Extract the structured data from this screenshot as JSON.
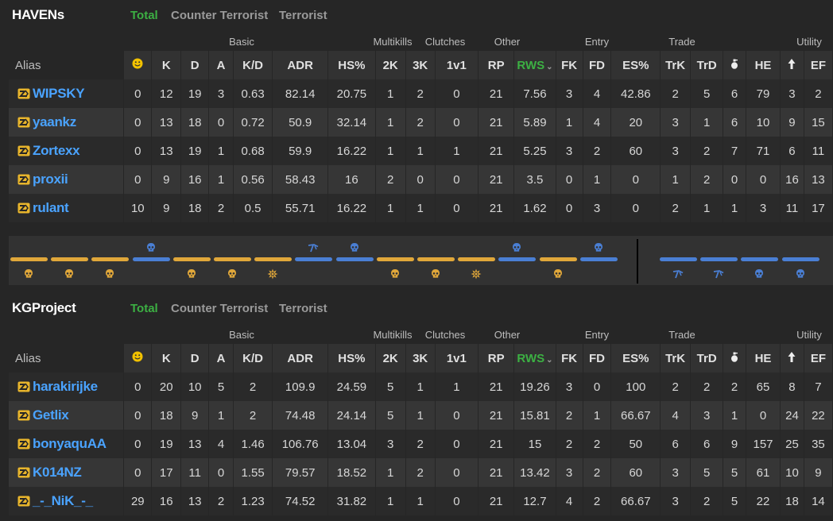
{
  "colors": {
    "accent_green": "#3cb043",
    "player_link": "#4aa3ff",
    "t_round": "#e0a73a",
    "ct_round": "#4a7fd4"
  },
  "tabs": {
    "total": "Total",
    "ct": "Counter Terrorist",
    "t": "Terrorist"
  },
  "groups": {
    "basic": "Basic",
    "multikills": "Multikills",
    "clutches": "Clutches",
    "other": "Other",
    "entry": "Entry",
    "trade": "Trade",
    "utility": "Utility"
  },
  "columns": {
    "alias": "Alias",
    "mvp_icon": "smiley-icon",
    "k": "K",
    "d": "D",
    "a": "A",
    "kd": "K/D",
    "adr": "ADR",
    "hs": "HS%",
    "mk2": "2K",
    "mk3": "3K",
    "clutch": "1v1",
    "rp": "RP",
    "rws": "RWS",
    "fk": "FK",
    "fd": "FD",
    "es": "ES%",
    "trk": "TrK",
    "trd": "TrD",
    "flash_icon": "flashbang-icon",
    "he": "HE",
    "util_icon": "arrow-up-icon",
    "ef": "EF"
  },
  "teams": [
    {
      "name": "HAVENs",
      "players": [
        {
          "alias": "WIPSKY",
          "stats": [
            "0",
            "12",
            "19",
            "3",
            "0.63",
            "82.14",
            "20.75",
            "1",
            "2",
            "0",
            "21",
            "7.56",
            "3",
            "4",
            "42.86",
            "2",
            "5",
            "6",
            "79",
            "3",
            "2"
          ]
        },
        {
          "alias": "yaankz",
          "stats": [
            "0",
            "13",
            "18",
            "0",
            "0.72",
            "50.9",
            "32.14",
            "1",
            "2",
            "0",
            "21",
            "5.89",
            "1",
            "4",
            "20",
            "3",
            "1",
            "6",
            "10",
            "9",
            "15"
          ]
        },
        {
          "alias": "Zortexx",
          "stats": [
            "0",
            "13",
            "19",
            "1",
            "0.68",
            "59.9",
            "16.22",
            "1",
            "1",
            "1",
            "21",
            "5.25",
            "3",
            "2",
            "60",
            "3",
            "2",
            "7",
            "71",
            "6",
            "11"
          ]
        },
        {
          "alias": "proxii",
          "stats": [
            "0",
            "9",
            "16",
            "1",
            "0.56",
            "58.43",
            "16",
            "2",
            "0",
            "0",
            "21",
            "3.5",
            "0",
            "1",
            "0",
            "1",
            "2",
            "0",
            "0",
            "16",
            "13"
          ]
        },
        {
          "alias": "rulant",
          "stats": [
            "10",
            "9",
            "18",
            "2",
            "0.5",
            "55.71",
            "16.22",
            "1",
            "1",
            "0",
            "21",
            "1.62",
            "0",
            "3",
            "0",
            "2",
            "1",
            "1",
            "3",
            "11",
            "17"
          ]
        }
      ]
    },
    {
      "name": "KGProject",
      "players": [
        {
          "alias": "harakirijke",
          "stats": [
            "0",
            "20",
            "10",
            "5",
            "2",
            "109.9",
            "24.59",
            "5",
            "1",
            "1",
            "21",
            "19.26",
            "3",
            "0",
            "100",
            "2",
            "2",
            "2",
            "65",
            "8",
            "7"
          ]
        },
        {
          "alias": "Getlix",
          "stats": [
            "0",
            "18",
            "9",
            "1",
            "2",
            "74.48",
            "24.14",
            "5",
            "1",
            "0",
            "21",
            "15.81",
            "2",
            "1",
            "66.67",
            "4",
            "3",
            "1",
            "0",
            "24",
            "22"
          ]
        },
        {
          "alias": "bonyaquAA",
          "stats": [
            "0",
            "19",
            "13",
            "4",
            "1.46",
            "106.76",
            "13.04",
            "3",
            "2",
            "0",
            "21",
            "15",
            "2",
            "2",
            "50",
            "6",
            "6",
            "9",
            "157",
            "25",
            "35"
          ]
        },
        {
          "alias": "K014NZ",
          "stats": [
            "0",
            "17",
            "11",
            "0",
            "1.55",
            "79.57",
            "18.52",
            "1",
            "2",
            "0",
            "21",
            "13.42",
            "3",
            "2",
            "60",
            "3",
            "5",
            "5",
            "61",
            "10",
            "9"
          ]
        },
        {
          "alias": "_-_NiK_-_",
          "stats": [
            "29",
            "16",
            "13",
            "2",
            "1.23",
            "74.52",
            "31.82",
            "1",
            "1",
            "0",
            "21",
            "12.7",
            "4",
            "2",
            "66.67",
            "3",
            "2",
            "5",
            "22",
            "18",
            "14"
          ]
        }
      ]
    }
  ],
  "rounds": [
    {
      "winner": "t",
      "icon": "skull-icon"
    },
    {
      "winner": "t",
      "icon": "skull-icon"
    },
    {
      "winner": "t",
      "icon": "skull-icon"
    },
    {
      "winner": "ct",
      "icon": "skull-icon"
    },
    {
      "winner": "t",
      "icon": "skull-icon"
    },
    {
      "winner": "t",
      "icon": "skull-icon"
    },
    {
      "winner": "t",
      "icon": "bomb-exploded-icon"
    },
    {
      "winner": "ct",
      "icon": "defuse-icon"
    },
    {
      "winner": "ct",
      "icon": "skull-icon"
    },
    {
      "winner": "t",
      "icon": "skull-icon"
    },
    {
      "winner": "t",
      "icon": "skull-icon"
    },
    {
      "winner": "t",
      "icon": "bomb-exploded-icon"
    },
    {
      "winner": "ct",
      "icon": "skull-icon"
    },
    {
      "winner": "t",
      "icon": "skull-icon"
    },
    {
      "winner": "ct",
      "icon": "skull-icon"
    },
    {
      "winner": "ct",
      "icon": "defuse-icon"
    },
    {
      "winner": "ct",
      "icon": "defuse-icon"
    },
    {
      "winner": "ct",
      "icon": "skull-icon"
    },
    {
      "winner": "ct",
      "icon": "skull-icon"
    }
  ]
}
